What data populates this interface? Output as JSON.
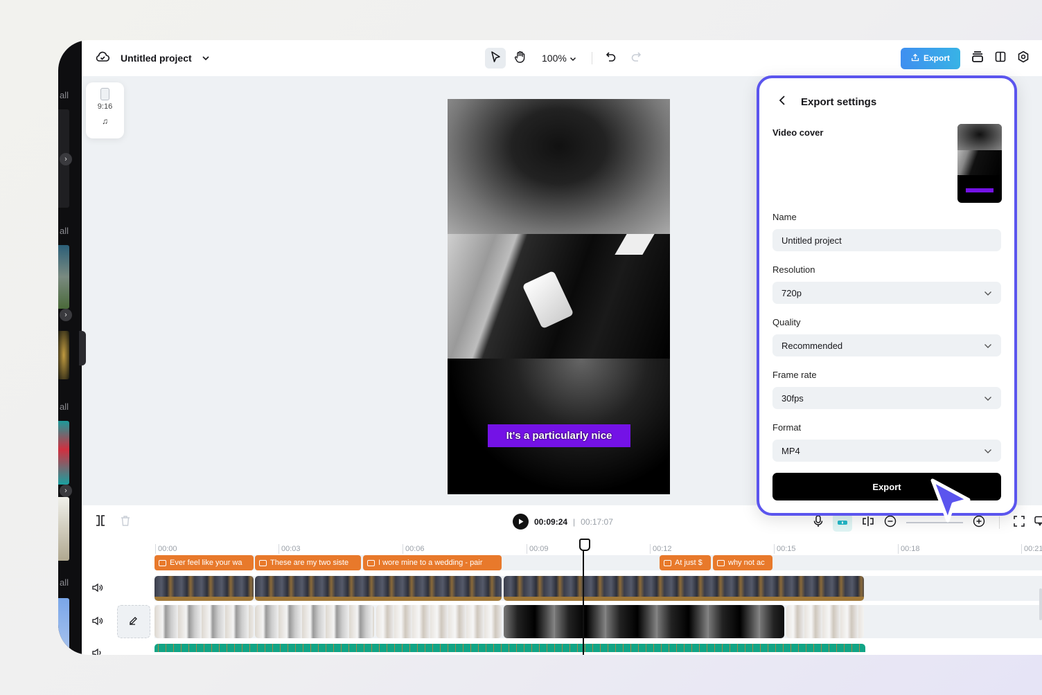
{
  "topbar": {
    "project_title": "Untitled project",
    "zoom_level": "100%",
    "export_label": "Export",
    "icons": [
      "cloud-check-icon",
      "chevron-down-icon",
      "select-pointer-icon",
      "hand-icon",
      "undo-icon",
      "redo-icon",
      "upload-icon",
      "layers-icon",
      "split-view-icon",
      "settings-icon"
    ]
  },
  "sidebar": {
    "see_all_labels": [
      "all",
      "all",
      "all",
      "all"
    ]
  },
  "ratio_card": {
    "ratio": "9:16",
    "platform_icon": "tiktok-icon"
  },
  "canvas": {
    "caption": "It's a particularly nice",
    "caption_color": "#7412e6"
  },
  "export_panel": {
    "title": "Export settings",
    "video_cover_label": "Video cover",
    "name_label": "Name",
    "name_value": "Untitled project",
    "resolution_label": "Resolution",
    "resolution_value": "720p",
    "quality_label": "Quality",
    "quality_value": "Recommended",
    "frame_rate_label": "Frame rate",
    "frame_rate_value": "30fps",
    "format_label": "Format",
    "format_value": "MP4",
    "export_button": "Export",
    "border_color": "#5b55ee"
  },
  "timeline": {
    "current_time": "00:09:24",
    "total_time": "00:17:07",
    "ruler_labels": [
      "00:00",
      "00:03",
      "00:06",
      "00:09",
      "00:12",
      "00:15",
      "00:18",
      "00:21"
    ],
    "captions": [
      {
        "text": "Ever feel like your wa"
      },
      {
        "text": "These are my two siste"
      },
      {
        "text": "I wore mine to a wedding - pair"
      },
      {
        "text": "At just $"
      },
      {
        "text": "why not ac"
      }
    ],
    "caption_color": "#e8792b",
    "audio_color": "#11a586"
  }
}
